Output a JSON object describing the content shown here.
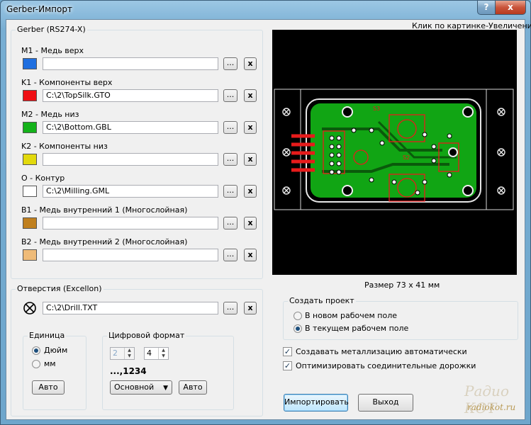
{
  "window": {
    "title": "Gerber-Импорт",
    "help": "?",
    "close": "x"
  },
  "gerber": {
    "title": "Gerber (RS274-X)",
    "layers": [
      {
        "label": "M1 - Медь верх",
        "path": "",
        "color": "#1f6fe0"
      },
      {
        "label": "K1 - Компоненты верх",
        "path": "C:\\2\\TopSilk.GTO",
        "color": "#ef0f14"
      },
      {
        "label": "M2 - Медь низ",
        "path": "C:\\2\\Bottom.GBL",
        "color": "#14b21a"
      },
      {
        "label": "K2 - Компоненты низ",
        "path": "",
        "color": "#e2d90c"
      },
      {
        "label": "O - Контур",
        "path": "C:\\2\\Milling.GML",
        "color": "#ffffff"
      },
      {
        "label": "B1 - Медь внутренний 1 (Многослойная)",
        "path": "",
        "color": "#c0801f"
      },
      {
        "label": "B2 - Медь внутренний 2 (Многослойная)",
        "path": "",
        "color": "#efbb78"
      }
    ],
    "browse_label": "...",
    "clear_label": "x"
  },
  "excellon": {
    "title": "Отверстия (Excellon)",
    "path": "C:\\2\\Drill.TXT",
    "browse_label": "...",
    "clear_label": "x"
  },
  "units": {
    "title": "Единица",
    "inch": "Дюйм",
    "mm": "мм",
    "selected": "inch",
    "auto": "Авто"
  },
  "format": {
    "title": "Цифровой формат",
    "int_digits": "2",
    "dec_digits": "4",
    "sample": "...,1234",
    "mode": "Основной",
    "auto": "Авто"
  },
  "preview": {
    "hint": "Клик по картинке-Увеличение",
    "size": "Размер 73 x 41 мм",
    "label_s3": "S3",
    "label_s2": "S2"
  },
  "project": {
    "title": "Создать проект",
    "new_field": "В новом рабочем поле",
    "current_field": "В текущем рабочем поле",
    "selected": "current"
  },
  "options": {
    "auto_metal": "Создавать металлизацию автоматически",
    "optimize": "Оптимизировать соединительные дорожки"
  },
  "actions": {
    "import": "Импортировать",
    "exit": "Выход"
  },
  "watermark": {
    "brand": "Радио КОТ",
    "site": "radiokot.ru"
  }
}
